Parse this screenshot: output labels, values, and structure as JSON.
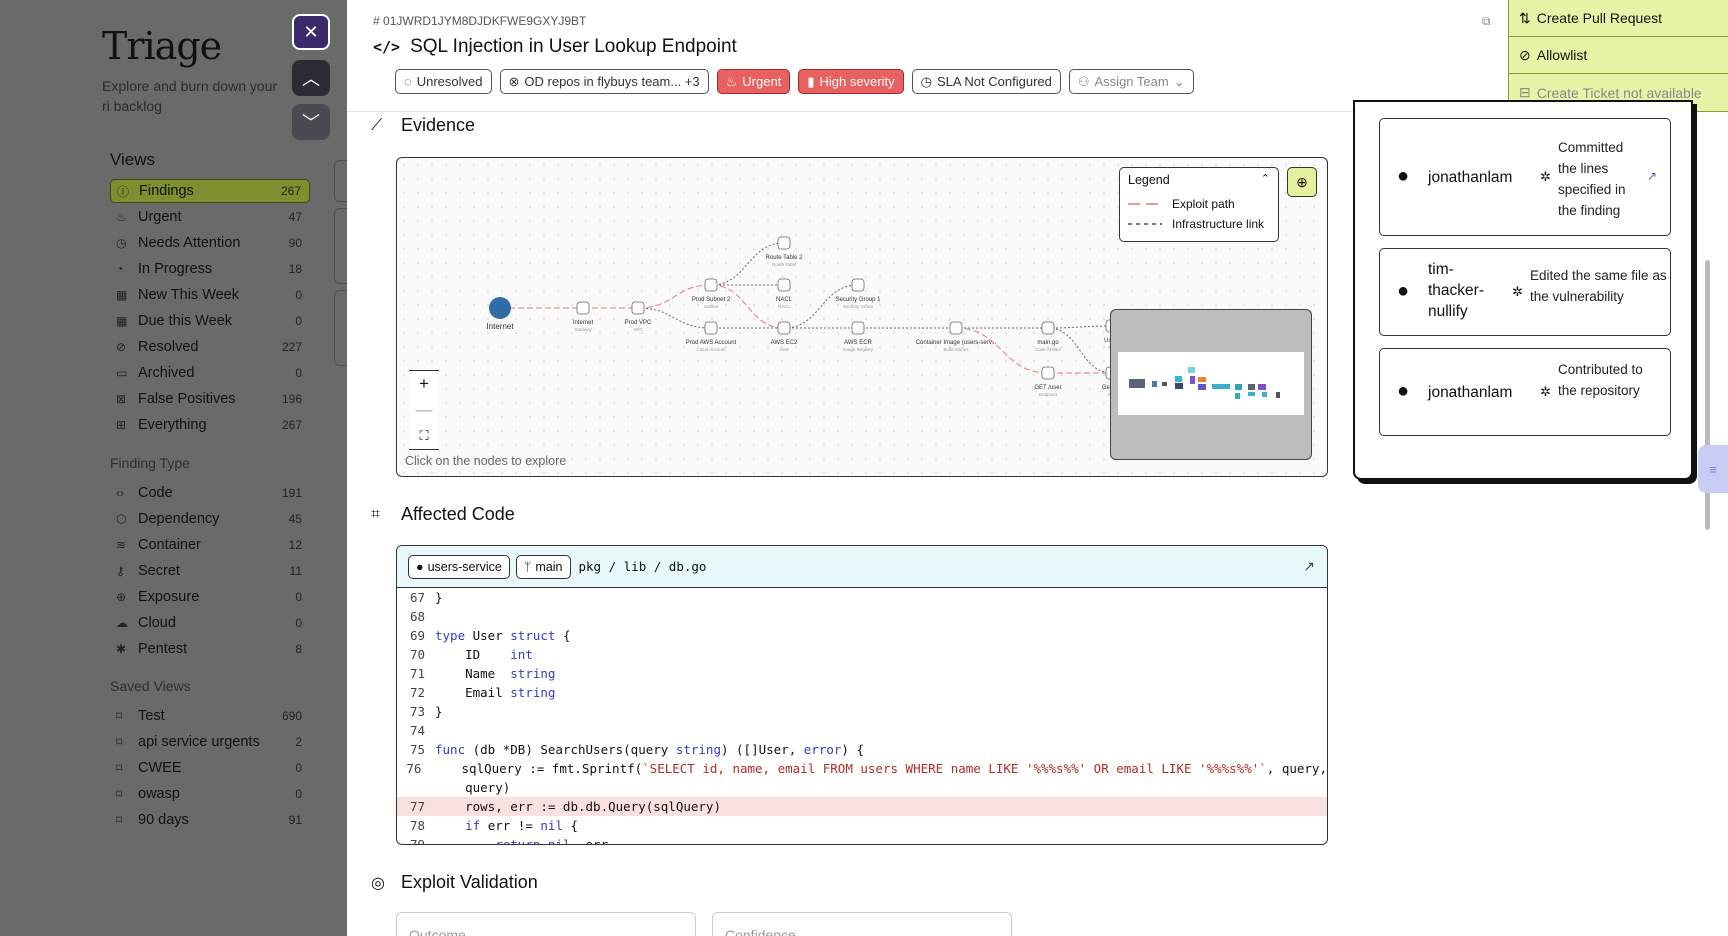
{
  "sidebar": {
    "app_title": "Triage",
    "subtitle": "Explore and burn down your ri backlog",
    "views_heading": "Views",
    "views": [
      {
        "label": "Findings",
        "count": "267",
        "icon": "alert-circle-icon",
        "active": true
      },
      {
        "label": "Urgent",
        "count": "47",
        "icon": "flame-icon"
      },
      {
        "label": "Needs Attention",
        "count": "90",
        "icon": "clock-icon"
      },
      {
        "label": "In Progress",
        "count": "18",
        "icon": "progress-icon"
      },
      {
        "label": "New This Week",
        "count": "0",
        "icon": "calendar-icon"
      },
      {
        "label": "Due this Week",
        "count": "0",
        "icon": "calendar-icon"
      },
      {
        "label": "Resolved",
        "count": "227",
        "icon": "check-circle-icon"
      },
      {
        "label": "Archived",
        "count": "0",
        "icon": "archive-icon"
      },
      {
        "label": "False Positives",
        "count": "196",
        "icon": "x-square-icon"
      },
      {
        "label": "Everything",
        "count": "267",
        "icon": "grid-icon"
      }
    ],
    "finding_type_heading": "Finding Type",
    "finding_types": [
      {
        "label": "Code",
        "count": "191",
        "icon": "code-icon"
      },
      {
        "label": "Dependency",
        "count": "45",
        "icon": "package-icon"
      },
      {
        "label": "Container",
        "count": "12",
        "icon": "layers-icon"
      },
      {
        "label": "Secret",
        "count": "11",
        "icon": "key-icon"
      },
      {
        "label": "Exposure",
        "count": "0",
        "icon": "globe-icon"
      },
      {
        "label": "Cloud",
        "count": "0",
        "icon": "cloud-icon"
      },
      {
        "label": "Pentest",
        "count": "8",
        "icon": "bug-icon"
      }
    ],
    "saved_views_heading": "Saved Views",
    "saved_views": [
      {
        "label": "Test",
        "count": "690",
        "icon": "bookmark-icon"
      },
      {
        "label": "api service urgents",
        "count": "2",
        "icon": "bookmark-icon"
      },
      {
        "label": "CWEE",
        "count": "0",
        "icon": "bookmark-icon"
      },
      {
        "label": "owasp",
        "count": "0",
        "icon": "bookmark-icon"
      },
      {
        "label": "90 days",
        "count": "91",
        "icon": "bookmark-icon"
      }
    ]
  },
  "header": {
    "finding_id": "01JWRD1JYM8DJDKFWE9GXYJ9BT",
    "title": "SQL Injection in User Lookup Endpoint",
    "chips": {
      "status": "Unresolved",
      "repos": "OD repos in flybuys team... +3",
      "urgency": "Urgent",
      "severity": "High severity",
      "sla": "SLA Not Configured",
      "assign": "Assign Team"
    }
  },
  "actions": {
    "create_pr": "Create Pull Request",
    "allowlist": "Allowlist",
    "create_ticket": "Create Ticket not available"
  },
  "evidence": {
    "heading": "Evidence",
    "legend_title": "Legend",
    "legend_items": [
      "Exploit path",
      "Infrastructure link"
    ],
    "hint": "Click on the nodes to explore",
    "nodes": [
      {
        "label": "Internet",
        "sub": ""
      },
      {
        "label": "Internet",
        "sub": "Gateway"
      },
      {
        "label": "Prod VPC",
        "sub": "VPC"
      },
      {
        "label": "Prod Subnet 2",
        "sub": "Subnet"
      },
      {
        "label": "Prod AWS Account",
        "sub": "Cloud Account"
      },
      {
        "label": "Route Table 2",
        "sub": "Route Table"
      },
      {
        "label": "NACL",
        "sub": "NACL"
      },
      {
        "label": "AWS EC2",
        "sub": "Host"
      },
      {
        "label": "Security Group 1",
        "sub": "Security Group"
      },
      {
        "label": "AWS ECR",
        "sub": "Image Registry"
      },
      {
        "label": "Container Image (users-serv...",
        "sub": "Build Artifact"
      },
      {
        "label": "main.go",
        "sub": "Code Artifact"
      },
      {
        "label": "GET /user",
        "sub": "Endpoint"
      },
      {
        "label": "Users",
        "sub": "Pro"
      },
      {
        "label": "GetUse",
        "sub": "Fun"
      }
    ]
  },
  "affected_code": {
    "heading": "Affected Code",
    "repo": "users-service",
    "branch": "main",
    "path": "pkg / lib / db.go",
    "highlighted_line": "77",
    "lines": [
      {
        "n": "67",
        "text": "}"
      },
      {
        "n": "68",
        "text": ""
      },
      {
        "n": "69",
        "text": "type User struct {"
      },
      {
        "n": "70",
        "text": "    ID    int"
      },
      {
        "n": "71",
        "text": "    Name  string"
      },
      {
        "n": "72",
        "text": "    Email string"
      },
      {
        "n": "73",
        "text": "}"
      },
      {
        "n": "74",
        "text": ""
      },
      {
        "n": "75",
        "text": "func (db *DB) SearchUsers(query string) ([]User, error) {"
      },
      {
        "n": "76",
        "text": "    sqlQuery := fmt.Sprintf(`SELECT id, name, email FROM users WHERE name LIKE '%%%s%%' OR email LIKE '%%%s%%'`, query,"
      },
      {
        "n": "",
        "text": "    query)"
      },
      {
        "n": "77",
        "text": "    rows, err := db.db.Query(sqlQuery)"
      },
      {
        "n": "78",
        "text": "    if err != nil {"
      },
      {
        "n": "79",
        "text": "        return nil, err"
      }
    ]
  },
  "contributors": [
    {
      "name": "jonathanlam",
      "desc": "Committed the lines specified in the finding"
    },
    {
      "name": "tim-thacker-nullify",
      "desc": "Edited the same file as the vulnerability"
    },
    {
      "name": "jonathanlam",
      "desc": "Contributed to the repository"
    }
  ],
  "exploit_validation": {
    "heading": "Exploit Validation",
    "outcome_label": "Outcome",
    "confidence_label": "Confidence"
  },
  "colors": {
    "accent": "#e5f5a8",
    "urgent": "#e86060",
    "active_nav": "#7d8f2f",
    "code_header": "#e8f8fb"
  }
}
